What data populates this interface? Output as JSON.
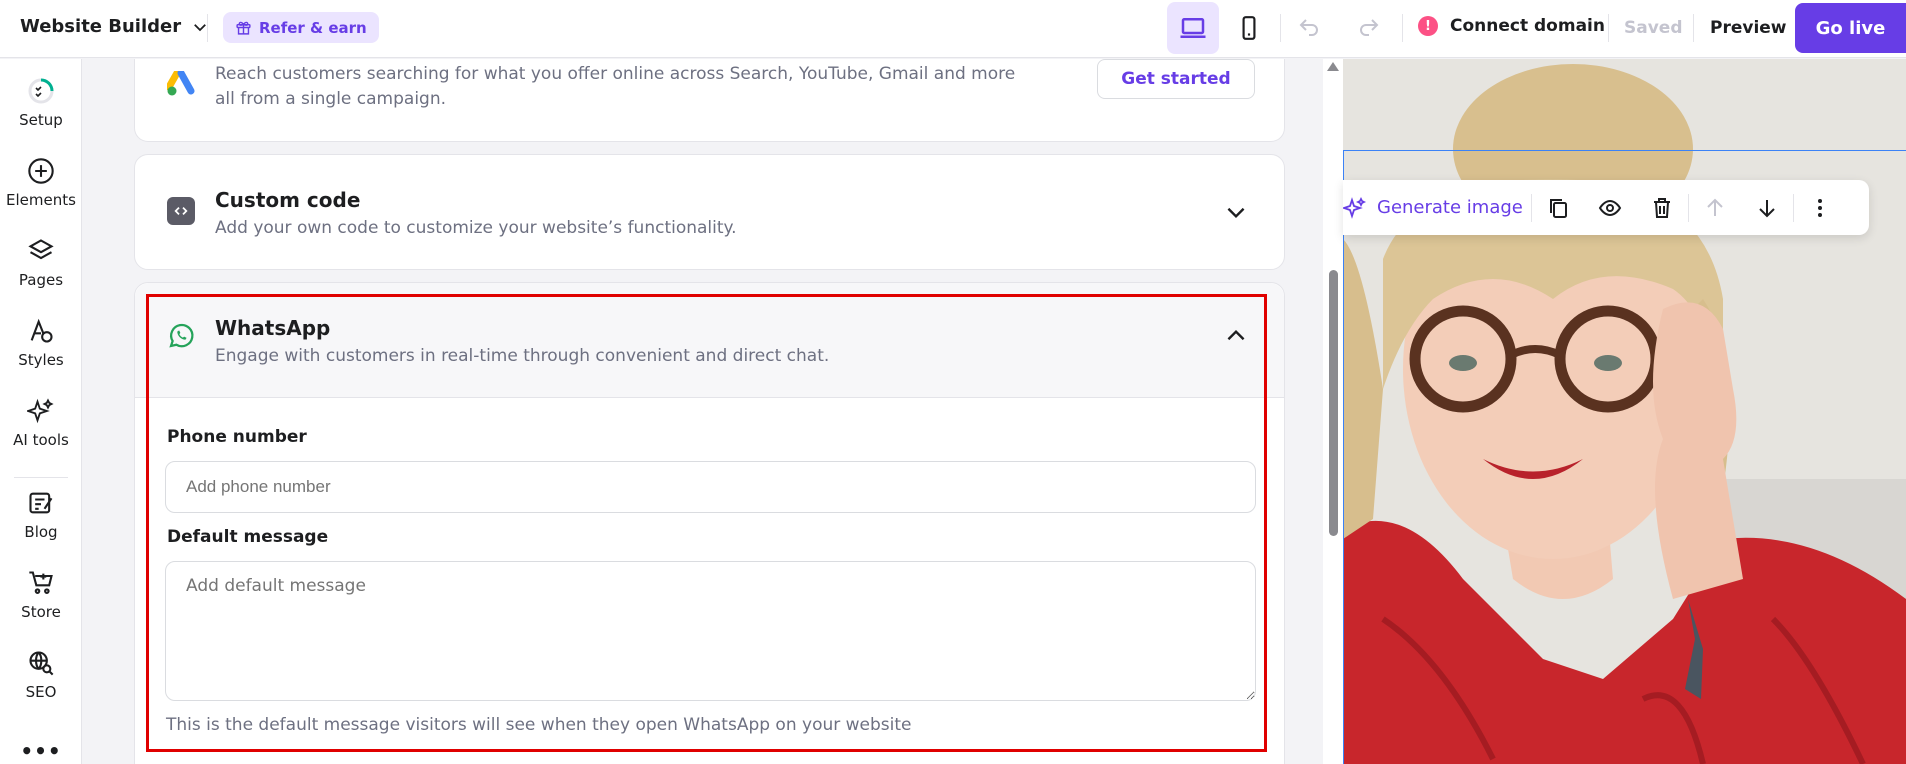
{
  "topbar": {
    "app_title": "Website Builder",
    "refer_label": "Refer & earn",
    "connect_domain": "Connect domain",
    "connect_alert": "!",
    "saved": "Saved",
    "preview": "Preview",
    "go_live": "Go live"
  },
  "sidebar": {
    "items": [
      {
        "label": "Setup"
      },
      {
        "label": "Elements"
      },
      {
        "label": "Pages"
      },
      {
        "label": "Styles"
      },
      {
        "label": "AI tools"
      },
      {
        "label": "Blog"
      },
      {
        "label": "Store"
      },
      {
        "label": "SEO"
      }
    ],
    "more": "•••"
  },
  "integrations": {
    "google_ads": {
      "desc": "Reach customers searching for what you offer online across Search, YouTube, Gmail and more all from a single campaign.",
      "button": "Get started"
    },
    "custom_code": {
      "title": "Custom code",
      "desc": "Add your own code to customize your website’s functionality."
    },
    "whatsapp": {
      "title": "WhatsApp",
      "desc": "Engage with customers in real-time through convenient and direct chat.",
      "phone_label": "Phone number",
      "phone_placeholder": "Add phone number",
      "message_label": "Default message",
      "message_placeholder": "Add default message",
      "help": "This is the default message visitors will see when they open WhatsApp on your website"
    }
  },
  "preview_toolbar": {
    "generate_image": "Generate image"
  },
  "colors": {
    "accent": "#673de6",
    "highlight": "#e00000",
    "alert": "#fc5185"
  }
}
